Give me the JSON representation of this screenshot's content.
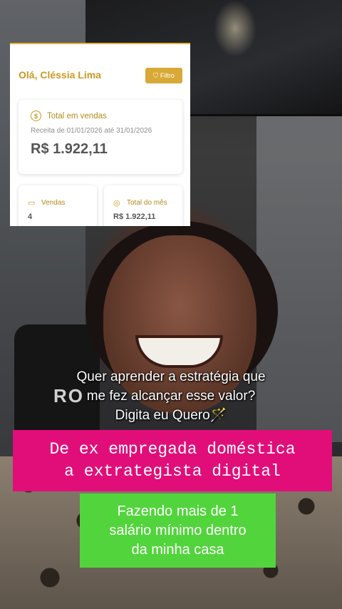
{
  "dashboard": {
    "greeting": "Olá, Cléssia Lima",
    "filter_label": "Filtro",
    "total_sales": {
      "title": "Total em vendas",
      "subtitle": "Receita de 01/01/2026 até 31/01/2026",
      "value": "R$ 1.922,11"
    },
    "sales_card": {
      "label": "Vendas",
      "value": "4"
    },
    "month_card": {
      "label": "Total do mês",
      "value": "R$ 1.922,11"
    }
  },
  "background": {
    "chair_logo": "RO"
  },
  "caption": {
    "line1": "Quer aprender a estratégia que",
    "line2": "me fez alcançar esse valor?",
    "line3": "Digita eu Quero🪄"
  },
  "banner_pink": {
    "line1": "De ex empregada doméstica",
    "line2": "a extrategista digital",
    "color": "#e10e79"
  },
  "banner_green": {
    "line1": "Fazendo mais de 1",
    "line2": "salário mínimo dentro",
    "line3": "da minha casa",
    "color": "#52d43c"
  },
  "accent_color": "#d8a936"
}
